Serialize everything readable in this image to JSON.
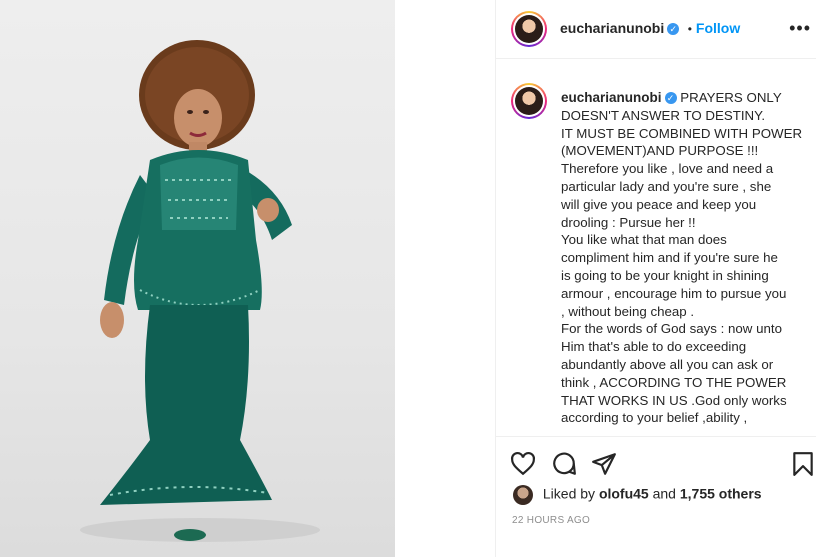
{
  "post": {
    "username": "eucharianunobi",
    "follow_separator": "•",
    "follow_label": "Follow",
    "more_label": "•••",
    "caption_lines": [
      "PRAYERS ONLY",
      "DOESN'T ANSWER TO DESTINY.",
      "IT MUST BE COMBINED WITH POWER",
      "(MOVEMENT)AND PURPOSE !!!",
      "Therefore you like , love and need a",
      "particular lady and you're sure , she",
      "will give you peace and keep you",
      "drooling : Pursue her !!",
      "You like what that man does",
      "compliment him and if you're sure he",
      "is going to be your knight in shining",
      "armour , encourage him to pursue you",
      ", without being cheap .",
      "For the words of God says : now unto",
      "Him that's able to do exceeding",
      "abundantly above all you can ask or",
      "think , ACCORDING TO THE POWER",
      "THAT WORKS IN US .God only works",
      "according to your belief ,ability ,"
    ],
    "likes_prefix": "Liked by",
    "likes_user": "olofu45",
    "likes_and": "and",
    "likes_count": "1,755 others",
    "timestamp": "22 HOURS AGO"
  },
  "colors": {
    "dress": "#146b5e",
    "accent": "#0095f6",
    "verified": "#3897f0"
  }
}
